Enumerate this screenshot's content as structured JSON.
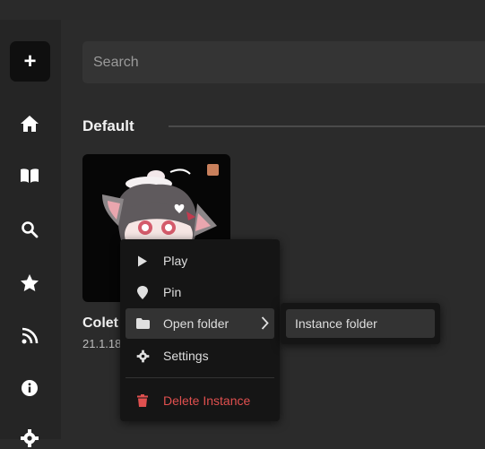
{
  "sidebar": {
    "add_label": "+",
    "items": [
      {
        "icon": "home-icon"
      },
      {
        "icon": "book-icon"
      },
      {
        "icon": "search-icon"
      },
      {
        "icon": "star-icon"
      },
      {
        "icon": "rss-icon"
      },
      {
        "icon": "info-icon"
      },
      {
        "icon": "gear-icon"
      }
    ]
  },
  "search": {
    "placeholder": "Search"
  },
  "section": {
    "title": "Default"
  },
  "instance": {
    "name": "Colet",
    "version": "21.1.18"
  },
  "context_menu": {
    "items": [
      {
        "label": "Play",
        "icon": "play-icon"
      },
      {
        "label": "Pin",
        "icon": "pin-icon"
      },
      {
        "label": "Open folder",
        "icon": "folder-icon"
      },
      {
        "label": "Settings",
        "icon": "gear-icon"
      },
      {
        "label": "Delete Instance",
        "icon": "trash-icon"
      }
    ]
  },
  "submenu": {
    "items": [
      {
        "label": "Instance folder"
      }
    ]
  },
  "colors": {
    "background": "#2b2b2b",
    "menu": "#151515",
    "danger": "#e0504f",
    "hover": "#333333"
  }
}
